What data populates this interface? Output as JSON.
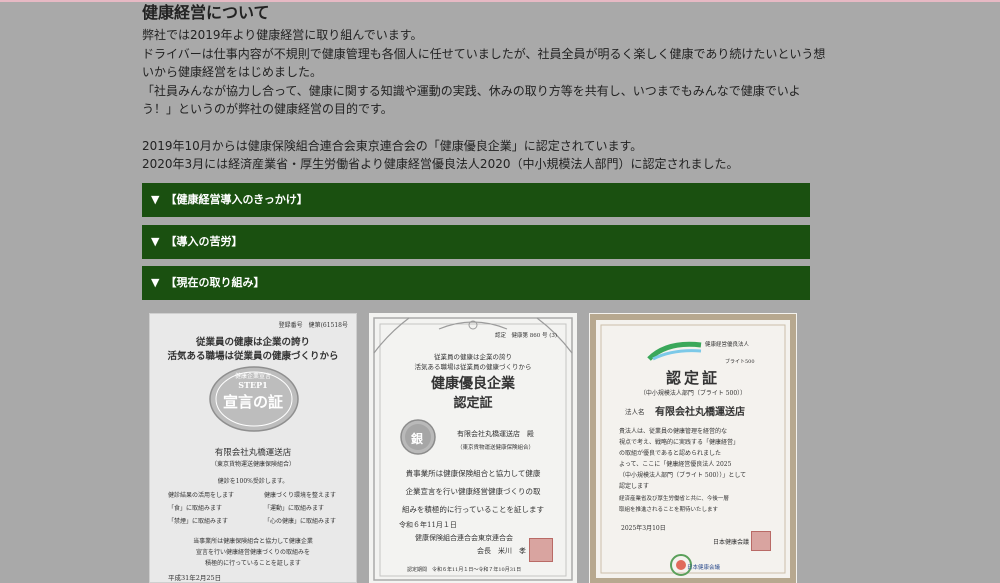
{
  "section": {
    "title": "健康経営について",
    "lines": [
      "弊社では2019年より健康経営に取り組んでいます。",
      "ドライバーは仕事内容が不規則で健康管理も各個人に任せていましたが、社員全員が明るく楽しく健康であり続けたいという想",
      "いから健康経営をはじめました。",
      "「社員みんなが協力し合って、健康に関する知識や運動の実践、休みの取り方等を共有し、いつまでもみんなで健康でいよ",
      "う！」というのが弊社の健康経営の目的です。"
    ],
    "lines2": [
      "2019年10月からは健康保険組合連合会東京連合会の「健康優良企業」に認定されています。",
      "2020年3月には経済産業省・厚生労働省より健康経営優良法人2020（中小規模法人部門）に認定されました。"
    ]
  },
  "accordions": [
    {
      "icon": "▼",
      "label": "【健康経営導入のきっかけ】"
    },
    {
      "icon": "▼",
      "label": "【導入の苦労】"
    },
    {
      "icon": "▼",
      "label": "【現在の取り組み】"
    }
  ],
  "certs": {
    "c1": {
      "reg": "登録番号　健第(61518号",
      "l1": "従業員の健康は企業の誇り",
      "l2": "活気ある職場は従業員の健康づくりから",
      "badge_top": "健康企業宣言",
      "badge_mid": "STEP1",
      "badge_main": "宣言の証",
      "company": "有限会社丸橋運送店",
      "sub": "（東京貨物運送健康保険組合）",
      "items": [
        "健診を100%受診します。",
        "健診結果の活用をします",
        "健康づくり環境を整えます",
        "「食」に取組みます",
        "「運動」に取組みます",
        "「禁煙」に取組みます",
        "「心の健康」に取組みます"
      ],
      "foot": [
        "当事業所は健康保険組合と協力して健康企業",
        "宣言を行い健康経営健康づくりの取組みを",
        "積極的に行っていることを証します"
      ],
      "date": "平成31年2月25日"
    },
    "c2": {
      "no": "認定　健康第 860 号 (3)",
      "l1": "従業員の健康は企業の誇り",
      "l2": "活気ある職場は従業員の健康づくりから",
      "t1": "健康優良企業",
      "t2": "認定証",
      "medal": "銀",
      "company": "有限会社丸橋運送店　殿",
      "sub": "（東京貨物運送健康保険組合）",
      "body": [
        "貴事業所は健康保険組合と協力して健康",
        "企業宣言を行い健康経営健康づくりの取",
        "組みを積極的に行っていることを証します"
      ],
      "date": "令和６年11月１日",
      "org": "健康保険組合連合会東京連合会",
      "chair": "会長　米川　孝",
      "period": "認定期間　令和６年11月１日〜令和７年10月31日"
    },
    "c3": {
      "brand1": "健康経営優良法人",
      "brand2": "ブライト500",
      "title": "認定証",
      "cat": "（中小規模法人部門（ブライト 500））",
      "label": "法人名",
      "company": "有限会社丸橋運送店",
      "body": [
        "貴法人は、従業員の健康管理を経営的な",
        "視点で考え、戦略的に実践する「健康経営」",
        "の取組が優良であると認められました",
        "よって、ここに「健康経営優良法人 2025",
        "（中小規模法人部門（ブライト 500））」として",
        "認定します",
        "経済産業省及び厚生労働省と共に、今後一層",
        "取組を推進されることを期待いたします"
      ],
      "date": "2025年3月10日",
      "org": "日本健康会議",
      "logo": "日本健康会議"
    }
  },
  "colors": {
    "accordion_bg": "#1a5010",
    "page_bg": "#a9a9a9"
  }
}
